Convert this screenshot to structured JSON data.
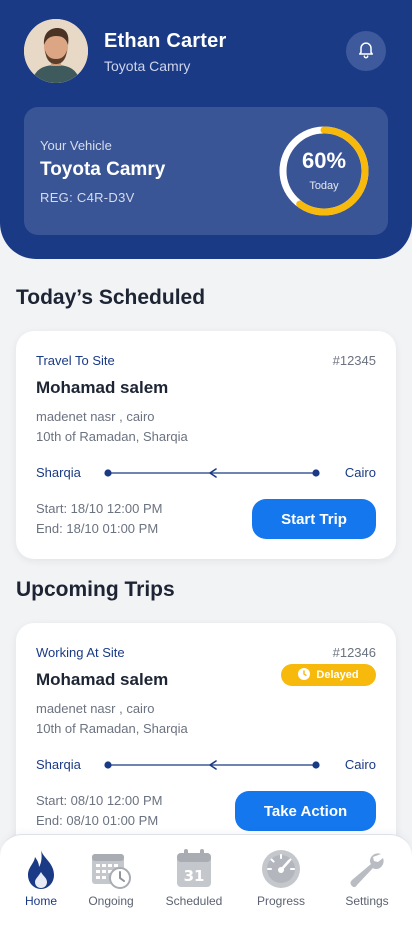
{
  "header": {
    "user_name": "Ethan Carter",
    "user_vehicle": "Toyota Camry"
  },
  "vehicle_card": {
    "label": "Your Vehicle",
    "name": "Toyota Camry",
    "reg": "REG: C4R-D3V",
    "progress_percent": 60,
    "progress_text": "60%",
    "progress_caption": "Today"
  },
  "sections": {
    "scheduled_title": "Today’s Scheduled",
    "upcoming_title": "Upcoming Trips"
  },
  "scheduled_trip": {
    "type": "Travel To Site",
    "id": "#12345",
    "passenger": "Mohamad salem",
    "address_line1": "madenet nasr , cairo",
    "address_line2": "10th of Ramadan, Sharqia",
    "from": "Sharqia",
    "to": "Cairo",
    "start": "Start: 18/10 12:00 PM",
    "end": "End: 18/10 01:00 PM",
    "action_label": "Start Trip"
  },
  "upcoming_trip": {
    "type": "Working At Site",
    "id": "#12346",
    "status": "Delayed",
    "passenger": "Mohamad salem",
    "address_line1": "madenet nasr , cairo",
    "address_line2": "10th of Ramadan, Sharqia",
    "from": "Sharqia",
    "to": "Cairo",
    "start": "Start: 08/10 12:00 PM",
    "end": "End: 08/10 01:00 PM",
    "action_label": "Take Action"
  },
  "bottom_nav": {
    "items": [
      {
        "label": "Home",
        "icon": "flame-icon",
        "active": true
      },
      {
        "label": "Ongoing",
        "icon": "calendar-clock-icon",
        "active": false
      },
      {
        "label": "Scheduled",
        "icon": "calendar-31-icon",
        "active": false
      },
      {
        "label": "Progress",
        "icon": "speedometer-icon",
        "active": false
      },
      {
        "label": "Settings",
        "icon": "wrench-icon",
        "active": false
      }
    ]
  },
  "colors": {
    "header_bg": "#1b3a85",
    "vehicle_card_bg": "#3a5596",
    "progress_ring": "#f7b90c",
    "primary_button": "#1577ee",
    "delayed_badge": "#f7b90c",
    "active_nav": "#1b3a85"
  }
}
